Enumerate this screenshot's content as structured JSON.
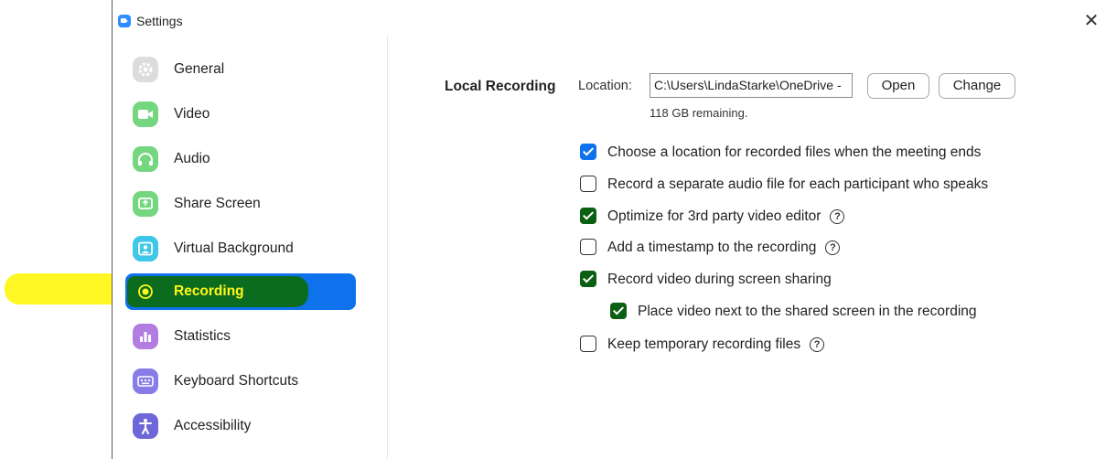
{
  "window": {
    "title": "Settings"
  },
  "sidebar": {
    "items": [
      {
        "label": "General",
        "icon": "gear-icon",
        "color": "#dcdcdc"
      },
      {
        "label": "Video",
        "icon": "camera-icon",
        "color": "#75d680"
      },
      {
        "label": "Audio",
        "icon": "headphones-icon",
        "color": "#75d680"
      },
      {
        "label": "Share Screen",
        "icon": "share-screen-icon",
        "color": "#75d680"
      },
      {
        "label": "Virtual Background",
        "icon": "person-icon",
        "color": "#3ec7e8"
      },
      {
        "label": "Recording",
        "icon": "record-icon",
        "color": "#0e72ed",
        "active": true
      },
      {
        "label": "Statistics",
        "icon": "bar-chart-icon",
        "color": "#b27ce0"
      },
      {
        "label": "Keyboard Shortcuts",
        "icon": "keyboard-icon",
        "color": "#8a7ce8"
      },
      {
        "label": "Accessibility",
        "icon": "accessibility-icon",
        "color": "#6e67d8"
      }
    ]
  },
  "recording": {
    "section_label": "Local Recording",
    "location_label": "Location:",
    "location_value": "C:\\Users\\LindaStarke\\OneDrive -",
    "open_label": "Open",
    "change_label": "Change",
    "remaining": "118 GB remaining.",
    "options": [
      {
        "label": "Choose a location for recorded files when the meeting ends",
        "checked": true,
        "help": false
      },
      {
        "label": "Record a separate audio file for each participant who speaks",
        "checked": false,
        "help": false
      },
      {
        "label": "Optimize for 3rd party video editor",
        "checked": true,
        "help": true
      },
      {
        "label": "Add a timestamp to the recording",
        "checked": false,
        "help": true
      },
      {
        "label": "Record video during screen sharing",
        "checked": true,
        "help": false
      },
      {
        "label": "Place video next to the shared screen in the recording",
        "checked": true,
        "help": false
      },
      {
        "label": "Keep temporary recording files",
        "checked": false,
        "help": true
      }
    ]
  },
  "colors": {
    "accent": "#0e72ed",
    "highlight": "#fff71a"
  }
}
